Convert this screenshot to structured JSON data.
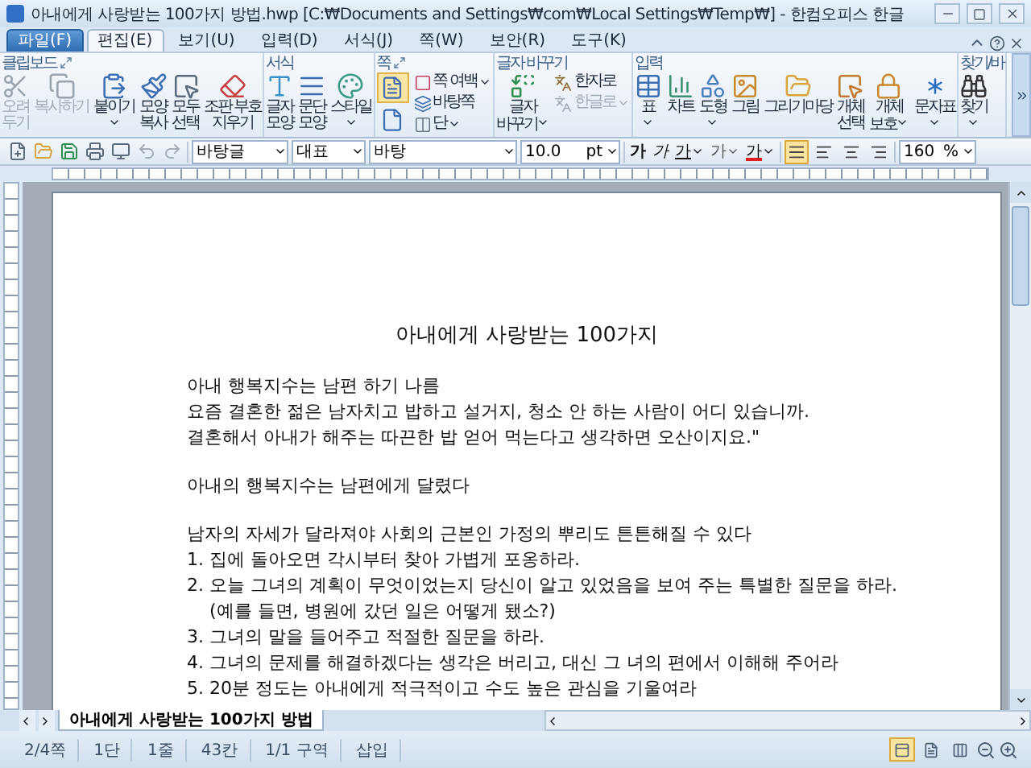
{
  "window": {
    "title": "아내에게 사랑받는 100가지 방법.hwp [C:₩Documents and Settings₩com₩Local Settings₩Temp₩] - 한컴오피스 한글"
  },
  "menu_tabs": [
    {
      "label": "파일(F)",
      "kind": "file",
      "selected": false
    },
    {
      "label": "편집(E)",
      "kind": "tab",
      "selected": true
    },
    {
      "label": "보기(U)",
      "kind": "tab",
      "selected": false
    },
    {
      "label": "입력(D)",
      "kind": "tab",
      "selected": false
    },
    {
      "label": "서식(J)",
      "kind": "tab",
      "selected": false
    },
    {
      "label": "쪽(W)",
      "kind": "tab",
      "selected": false
    },
    {
      "label": "보안(R)",
      "kind": "tab",
      "selected": false
    },
    {
      "label": "도구(K)",
      "kind": "tab",
      "selected": false
    }
  ],
  "ribbon": {
    "groups": [
      {
        "title": "클립보드",
        "dialog": true,
        "items": [
          {
            "label": "오려\n두기",
            "kind": "big",
            "disabled": true,
            "dropdown": false
          },
          {
            "label": "복사하기",
            "kind": "big",
            "disabled": true,
            "dropdown": false
          },
          {
            "label": "붙이기",
            "kind": "big",
            "disabled": false,
            "dropdown": true
          },
          {
            "label": "모양\n복사",
            "kind": "big",
            "disabled": false,
            "dropdown": false
          },
          {
            "label": "모두\n선택",
            "kind": "big",
            "disabled": false,
            "dropdown": false
          },
          {
            "label": "조판 부호\n지우기",
            "kind": "big",
            "disabled": false,
            "dropdown": false
          }
        ]
      },
      {
        "title": "서식",
        "dialog": false,
        "items": [
          {
            "label": "글자\n모양",
            "kind": "big",
            "disabled": false,
            "dropdown": false
          },
          {
            "label": "문단\n모양",
            "kind": "big",
            "disabled": false,
            "dropdown": false
          },
          {
            "label": "스타일",
            "kind": "big",
            "disabled": false,
            "dropdown": true
          }
        ]
      },
      {
        "title": "쪽",
        "dialog": true,
        "items": [
          {
            "kind": "icon",
            "selected": true
          },
          {
            "kind": "icon",
            "selected": false
          },
          {
            "label": "쪽 여백",
            "kind": "small",
            "disabled": false,
            "dropdown": true
          },
          {
            "label": "바탕쪽",
            "kind": "small",
            "disabled": false,
            "dropdown": false
          },
          {
            "label": "단",
            "kind": "small",
            "disabled": false,
            "dropdown": true
          }
        ]
      },
      {
        "title": "글자 바꾸기",
        "dialog": false,
        "items": [
          {
            "label": "글자\n바꾸기",
            "kind": "big",
            "disabled": false,
            "dropdown": true
          },
          {
            "label": "한자로",
            "kind": "small",
            "disabled": false,
            "dropdown": false
          },
          {
            "label": "한글로",
            "kind": "small",
            "disabled": true,
            "dropdown": true
          }
        ]
      },
      {
        "title": "입력",
        "dialog": false,
        "items": [
          {
            "label": "표",
            "kind": "big",
            "disabled": false,
            "dropdown": true
          },
          {
            "label": "차트",
            "kind": "big",
            "disabled": false,
            "dropdown": false
          },
          {
            "label": "도형",
            "kind": "big",
            "disabled": false,
            "dropdown": true
          },
          {
            "label": "그림",
            "kind": "big",
            "disabled": false,
            "dropdown": false
          },
          {
            "label": "그리기마당",
            "kind": "big",
            "disabled": false,
            "dropdown": false
          },
          {
            "label": "개체\n선택",
            "kind": "big",
            "disabled": false,
            "dropdown": false
          },
          {
            "label": "개체\n보호",
            "kind": "big",
            "disabled": false,
            "dropdown": true
          },
          {
            "label": "문자표",
            "kind": "big",
            "disabled": false,
            "dropdown": true
          }
        ]
      },
      {
        "title": "찾기/바",
        "dialog": false,
        "items": [
          {
            "label": "찾기",
            "kind": "big",
            "disabled": false,
            "dropdown": true
          }
        ]
      }
    ]
  },
  "toolbar": {
    "style": "바탕글",
    "language": "대표",
    "font": "바탕",
    "size": "10.0",
    "unit": "pt",
    "format_buttons": [
      {
        "label": "가",
        "kind": "bold",
        "dropdown": false
      },
      {
        "label": "가",
        "kind": "italic",
        "dropdown": false
      },
      {
        "label": "가",
        "kind": "underline",
        "dropdown": true
      },
      {
        "label": "가",
        "kind": "outline",
        "dropdown": true
      },
      {
        "label": "가",
        "kind": "color",
        "dropdown": true
      }
    ],
    "align_buttons": [
      {
        "kind": "justify",
        "selected": true
      },
      {
        "kind": "left",
        "selected": false
      },
      {
        "kind": "center",
        "selected": false
      },
      {
        "kind": "right",
        "selected": false
      }
    ],
    "zoom": "160",
    "zoom_unit": "%"
  },
  "document": {
    "title": "아내에게 사랑받는 100가지",
    "paragraphs": [
      [
        {
          "text": "아내 행복지수는 남편 하기 나름",
          "kind": "plain"
        },
        {
          "text": "요즘 결혼한 젊은 남자치고 밥하고 설거지, 청소 안 하는 사람이 어디 있습니까.",
          "kind": "plain"
        },
        {
          "text": "결혼해서 아내가 해주는 따끈한 밥 얻어 먹는다고 생각하면 오산이지요.\"",
          "kind": "plain"
        }
      ],
      [
        {
          "text": "아내의 행복지수는 남편에게 달렸다",
          "kind": "plain"
        }
      ],
      [
        {
          "text": "남자의 자세가 달라져야 사회의 근본인 가정의 뿌리도 튼튼해질 수 있다",
          "kind": "plain"
        },
        {
          "text": "1. 집에 돌아오면 각시부터 찾아 가볍게 포옹하라.",
          "kind": "plain"
        },
        {
          "text": "2. 오늘 그녀의 계획이 무엇이었는지 당신이 알고 있었음을 보여 주는 특별한 질문을 하라.",
          "kind": "plain"
        },
        {
          "text": "(예를 들면, 병원에 갔던 일은 어떻게 됐소?)",
          "kind": "continued"
        },
        {
          "text": "3. 그녀의 말을 들어주고 적절한 질문을 하라.",
          "kind": "plain"
        },
        {
          "text": "4. 그녀의 문제를 해결하겠다는 생각은 버리고, 대신 그 녀의 편에서 이해해 주어라",
          "kind": "plain"
        },
        {
          "text": "5. 20분 정도는 아내에게 적극적이고 수도 높은 관심을 기울여라",
          "kind": "plain"
        }
      ]
    ]
  },
  "doc_tabs": [
    {
      "label": "아내에게 사랑받는 100가지 방법",
      "selected": true
    }
  ],
  "status_bar": {
    "items": [
      "2/4쪽",
      "1단",
      "1줄",
      "43칸",
      "1/1 구역",
      "삽입"
    ],
    "view_buttons": [
      {
        "selected": true
      },
      {
        "selected": false
      },
      {
        "selected": false
      }
    ]
  }
}
